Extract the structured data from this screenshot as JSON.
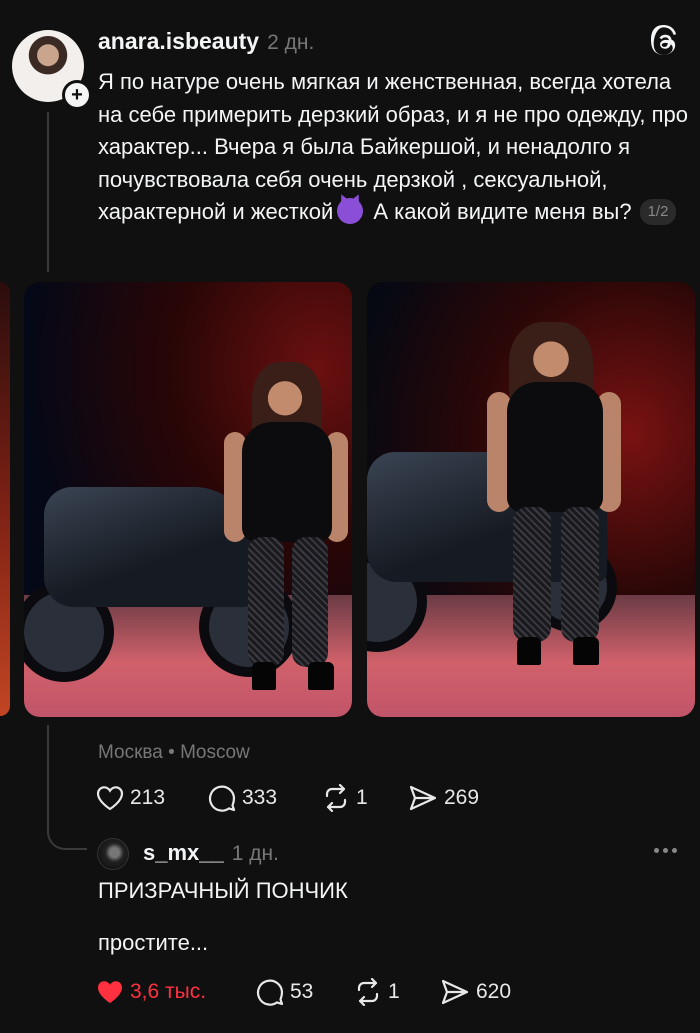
{
  "post": {
    "username": "anara.isbeauty",
    "time": "2 дн.",
    "text": "Я по натуре очень мягкая и женственная, всегда хотела на себе примерить дерзкий образ, и я не про одежду, про характер... Вчера я была Байкершой, и ненадолго я почувствовала себя очень дерзкой , сексуальной, характерной и жесткой",
    "text_tail": "А какой видите меня вы?",
    "page_indicator": "1/2",
    "location": "Москва • Moscow",
    "stats": {
      "likes": "213",
      "comments": "333",
      "reposts": "1",
      "shares": "269"
    }
  },
  "reply": {
    "username": "s_mx__",
    "time": "1 дн.",
    "line1": "ПРИЗРАЧНЫЙ ПОНЧИК",
    "line2": "простите...",
    "stats": {
      "likes": "3,6 тыс.",
      "comments": "53",
      "reposts": "1",
      "shares": "620"
    }
  },
  "icons": {
    "like": "heart-icon",
    "comment": "comment-icon",
    "repost": "repost-icon",
    "share": "send-icon",
    "app": "threads-icon",
    "more": "more-icon",
    "follow": "plus-icon"
  },
  "colors": {
    "background": "#101010",
    "text": "#f3f5f7",
    "muted": "#777777",
    "liked": "#ff3040"
  }
}
